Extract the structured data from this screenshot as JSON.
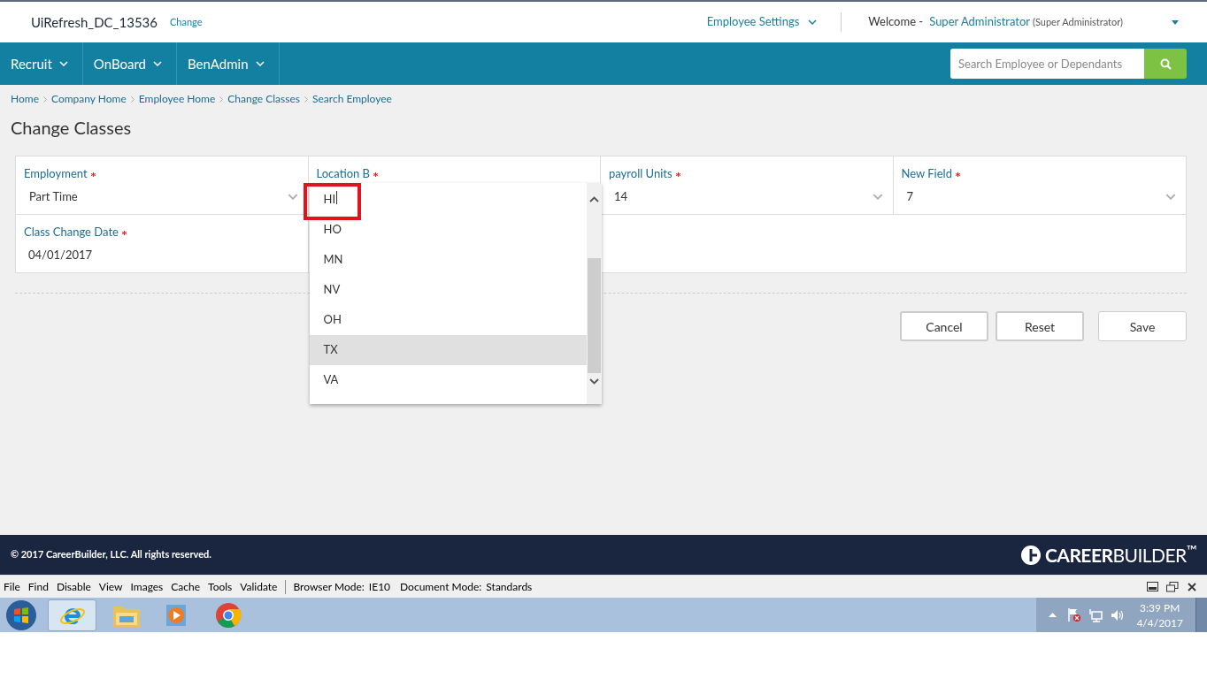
{
  "header": {
    "site": "UiRefresh_DC_13536",
    "change_link": "Change",
    "settings_menu": "Employee Settings",
    "welcome": "Welcome -",
    "user": "Super Administrator",
    "role": "(Super Administrator)"
  },
  "nav": {
    "items": [
      {
        "label": "Recruit"
      },
      {
        "label": "OnBoard"
      },
      {
        "label": "BenAdmin"
      }
    ],
    "search": {
      "placeholder": "Search Employee or Dependants"
    }
  },
  "breadcrumb": [
    "Home",
    "Company Home",
    "Employee Home",
    "Change Classes",
    "Search Employee"
  ],
  "page_title": "Change Classes",
  "fields": [
    {
      "kind": "select",
      "label": "Employment",
      "required": true,
      "value": "Part Time",
      "open": false
    },
    {
      "kind": "select",
      "label": "Location B",
      "required": true,
      "open": true
    },
    {
      "kind": "select",
      "label": "payroll Units",
      "required": true,
      "value": "14",
      "open": false
    },
    {
      "kind": "select",
      "label": "New Field",
      "required": true,
      "value": "7",
      "open": false
    },
    {
      "kind": "date",
      "label": "Class Change Date",
      "required": true,
      "value": "04/01/2017",
      "open": false
    }
  ],
  "dropdown_options": [
    {
      "label": "HI",
      "selected": false,
      "annotated": true
    },
    {
      "label": "HO",
      "selected": false,
      "annotated": false
    },
    {
      "label": "MN",
      "selected": false,
      "annotated": false
    },
    {
      "label": "NV",
      "selected": false,
      "annotated": false
    },
    {
      "label": "OH",
      "selected": false,
      "annotated": false
    },
    {
      "label": "TX",
      "selected": true,
      "annotated": false
    },
    {
      "label": "VA",
      "selected": false,
      "annotated": false
    }
  ],
  "buttons": [
    {
      "label": "Cancel",
      "kind": "secondary"
    },
    {
      "label": "Reset",
      "kind": "secondary"
    },
    {
      "label": "Save",
      "kind": "primary"
    }
  ],
  "footer": {
    "copyright": "© 2017 CareerBuilder, LLC. All rights reserved.",
    "logo": "**CAREER**BUILDER$^{™}$"
  },
  "devtools": {
    "menu": [
      "File",
      "Find",
      "Disable",
      "View",
      "Images",
      "Cache",
      "Tools",
      "Validate"
    ],
    "browser_mode_label": "Browser Mode:",
    "browser_mode": "IE10",
    "document_mode_label": "Document Mode:",
    "document_mode": "Standards"
  },
  "taskbar": {
    "time": "3:39 PM",
    "date": "4/4/2017"
  }
}
